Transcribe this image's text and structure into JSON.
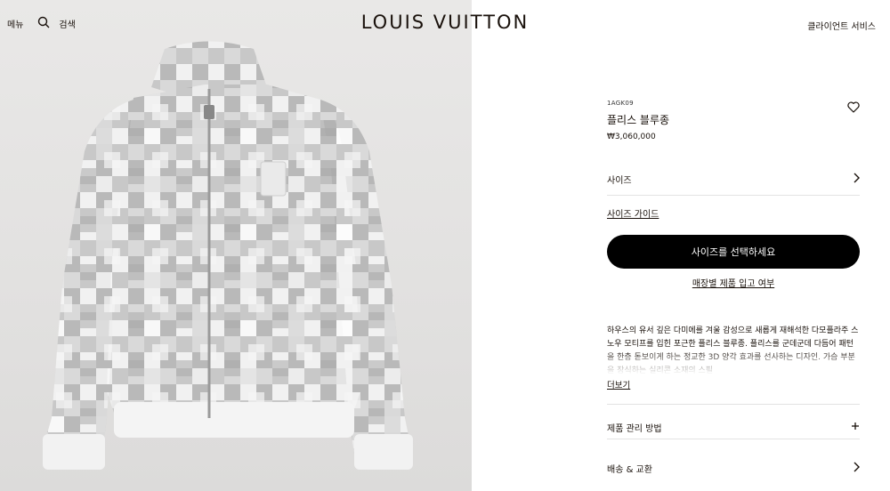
{
  "header": {
    "menu_label": "메뉴",
    "search_label": "검색",
    "brand": "LOUIS VUITTON",
    "client_service": "클라이언트 서비스"
  },
  "product": {
    "sku": "1AGK09",
    "name": "플리스 블루종",
    "price": "₩3,060,000",
    "size_label": "사이즈",
    "size_guide": "사이즈 가이드",
    "cta": "사이즈를 선택하세요",
    "stock_check": "매장별 제품 입고 여부",
    "description": "하우스의 유서 깊은 다미에를 겨울 감성으로 새롭게 재해석한 다모플라주 스노우 모티프를 입힌 포근한 플리스 블루종. 플리스를 군데군데 다듬어 패턴을 한층 돋보이게 하는 정교한 3D 양각 효과를 선사하는 디자인. 가슴 부분을 장식하는 실리콘 소재의 스필",
    "more": "더보기",
    "care_label": "제품 관리 방법",
    "shipping_label": "배송 & 교환"
  },
  "icons": {
    "search": "magnifier",
    "wishlist": "heart-outline",
    "chevron": "chevron-right",
    "plus": "plus"
  },
  "colors": {
    "text": "#19110b",
    "cta_bg": "#000000",
    "divider": "#e3e3e3"
  }
}
